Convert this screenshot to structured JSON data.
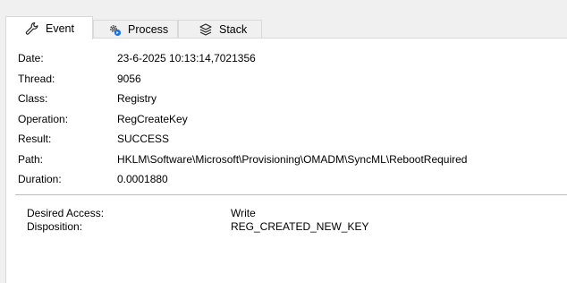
{
  "tabs": [
    {
      "label": "Event",
      "icon": "wrench-icon",
      "active": true
    },
    {
      "label": "Process",
      "icon": "process-gear-icon",
      "active": false
    },
    {
      "label": "Stack",
      "icon": "stack-layers-icon",
      "active": false
    }
  ],
  "fields": [
    {
      "label": "Date:",
      "value": "23-6-2025 10:13:14,7021356"
    },
    {
      "label": "Thread:",
      "value": "9056"
    },
    {
      "label": "Class:",
      "value": "Registry"
    },
    {
      "label": "Operation:",
      "value": "RegCreateKey"
    },
    {
      "label": "Result:",
      "value": "SUCCESS"
    },
    {
      "label": "Path:",
      "value": "HKLM\\Software\\Microsoft\\Provisioning\\OMADM\\SyncML\\RebootRequired"
    },
    {
      "label": "Duration:",
      "value": "0.0001880"
    }
  ],
  "details": [
    {
      "label": "Desired Access:",
      "value": "Write"
    },
    {
      "label": "Disposition:",
      "value": "REG_CREATED_NEW_KEY"
    }
  ],
  "colors": {
    "accent": "#1a73e8",
    "border": "#d9d9d9"
  }
}
